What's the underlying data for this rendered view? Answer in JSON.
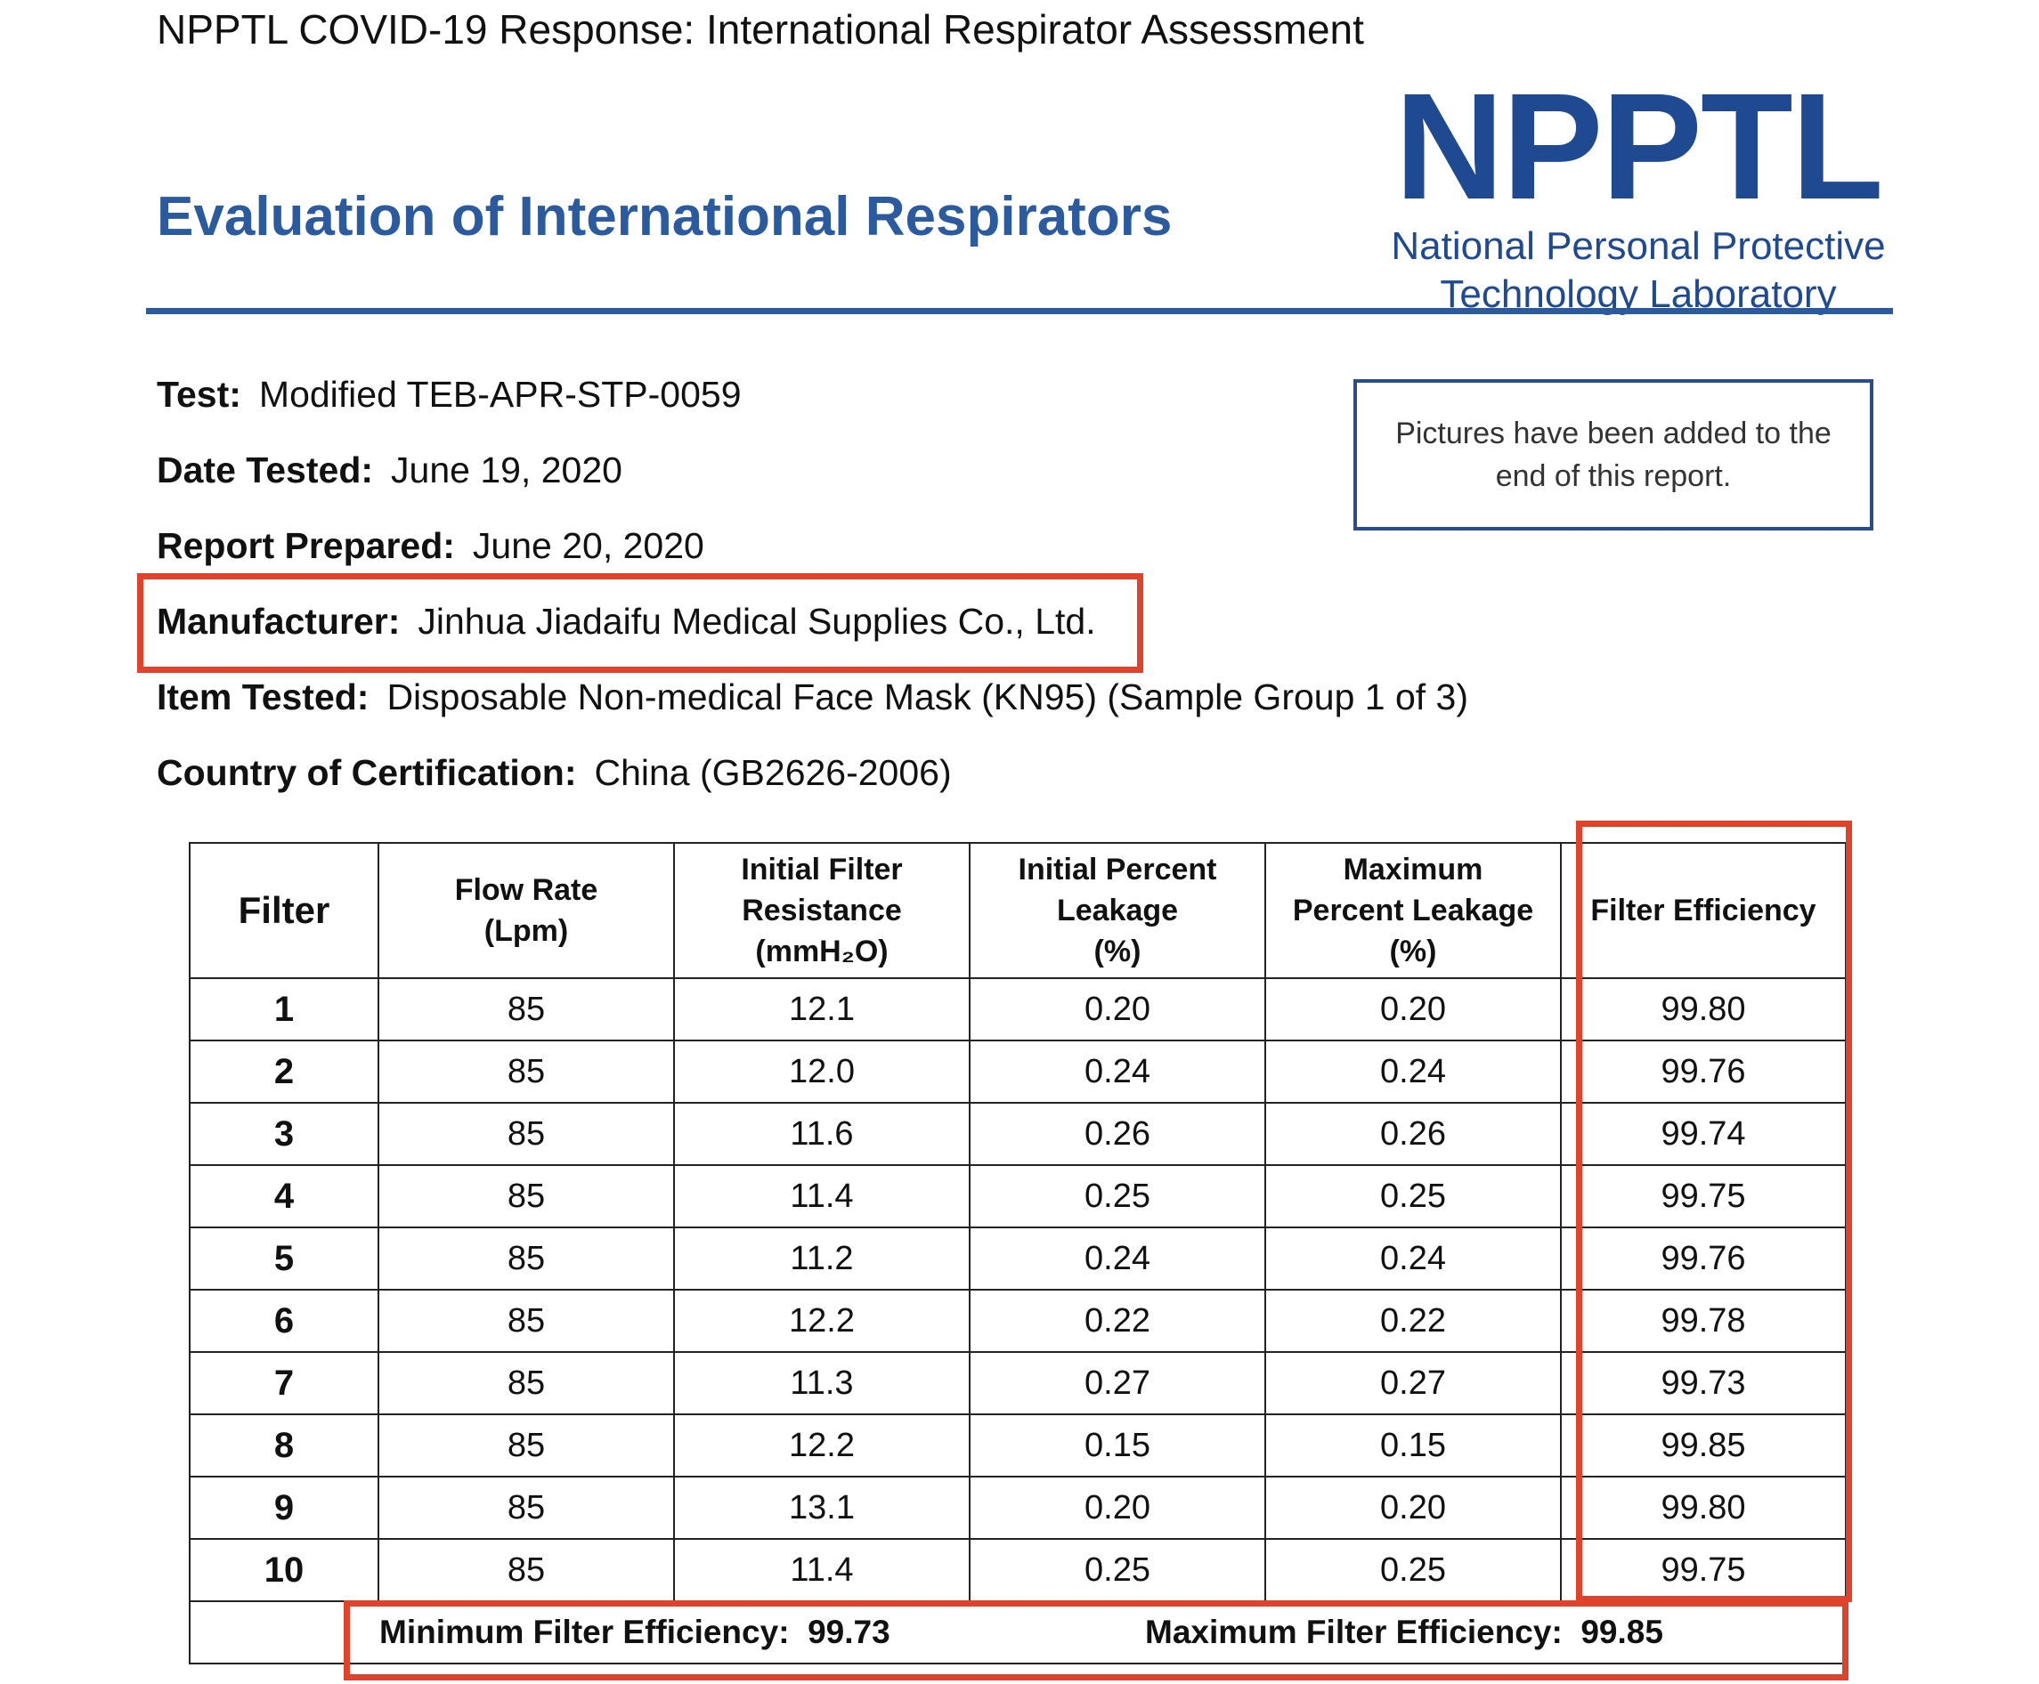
{
  "header": {
    "top_line": "NPPTL COVID-19 Response: International Respirator Assessment",
    "title": "Evaluation of International Respirators"
  },
  "logo": {
    "mark": "NPPTL",
    "line1": "National Personal Protective",
    "line2": "Technology Laboratory"
  },
  "meta": {
    "test_label": "Test:",
    "test_value": "Modified TEB-APR-STP-0059",
    "date_label": "Date Tested:",
    "date_value": "June 19, 2020",
    "report_label": "Report Prepared:",
    "report_value": "June 20, 2020",
    "manufacturer_label": "Manufacturer:",
    "manufacturer_value": "Jinhua Jiadaifu Medical Supplies Co., Ltd.",
    "item_label": "Item Tested:",
    "item_value": "Disposable Non-medical Face Mask (KN95) (Sample Group 1 of 3)",
    "country_label": "Country of Certification:",
    "country_value": "China (GB2626-2006)"
  },
  "note": "Pictures have been added to the end of this report.",
  "table": {
    "headers": {
      "filter": "Filter",
      "flow_1": "Flow Rate",
      "flow_2": "(Lpm)",
      "res_1": "Initial Filter",
      "res_2": "Resistance",
      "res_3": "(mmH₂O)",
      "ipl_1": "Initial Percent",
      "ipl_2": "Leakage",
      "ipl_3": "(%)",
      "mpl_1": "Maximum",
      "mpl_2": "Percent Leakage",
      "mpl_3": "(%)",
      "eff": "Filter Efficiency"
    },
    "rows": [
      {
        "filter": "1",
        "flow": "85",
        "resistance": "12.1",
        "initial": "0.20",
        "maximum": "0.20",
        "efficiency": "99.80"
      },
      {
        "filter": "2",
        "flow": "85",
        "resistance": "12.0",
        "initial": "0.24",
        "maximum": "0.24",
        "efficiency": "99.76"
      },
      {
        "filter": "3",
        "flow": "85",
        "resistance": "11.6",
        "initial": "0.26",
        "maximum": "0.26",
        "efficiency": "99.74"
      },
      {
        "filter": "4",
        "flow": "85",
        "resistance": "11.4",
        "initial": "0.25",
        "maximum": "0.25",
        "efficiency": "99.75"
      },
      {
        "filter": "5",
        "flow": "85",
        "resistance": "11.2",
        "initial": "0.24",
        "maximum": "0.24",
        "efficiency": "99.76"
      },
      {
        "filter": "6",
        "flow": "85",
        "resistance": "12.2",
        "initial": "0.22",
        "maximum": "0.22",
        "efficiency": "99.78"
      },
      {
        "filter": "7",
        "flow": "85",
        "resistance": "11.3",
        "initial": "0.27",
        "maximum": "0.27",
        "efficiency": "99.73"
      },
      {
        "filter": "8",
        "flow": "85",
        "resistance": "12.2",
        "initial": "0.15",
        "maximum": "0.15",
        "efficiency": "99.85"
      },
      {
        "filter": "9",
        "flow": "85",
        "resistance": "13.1",
        "initial": "0.20",
        "maximum": "0.20",
        "efficiency": "99.80"
      },
      {
        "filter": "10",
        "flow": "85",
        "resistance": "11.4",
        "initial": "0.25",
        "maximum": "0.25",
        "efficiency": "99.75"
      }
    ],
    "summary": {
      "min_label": "Minimum Filter Efficiency:",
      "min_value": "99.73",
      "max_label": "Maximum Filter Efficiency:",
      "max_value": "99.85"
    }
  },
  "colors": {
    "title_blue": "#2b5a9e",
    "logo_blue": "#1f4a92",
    "highlight_red": "#e0432b"
  }
}
